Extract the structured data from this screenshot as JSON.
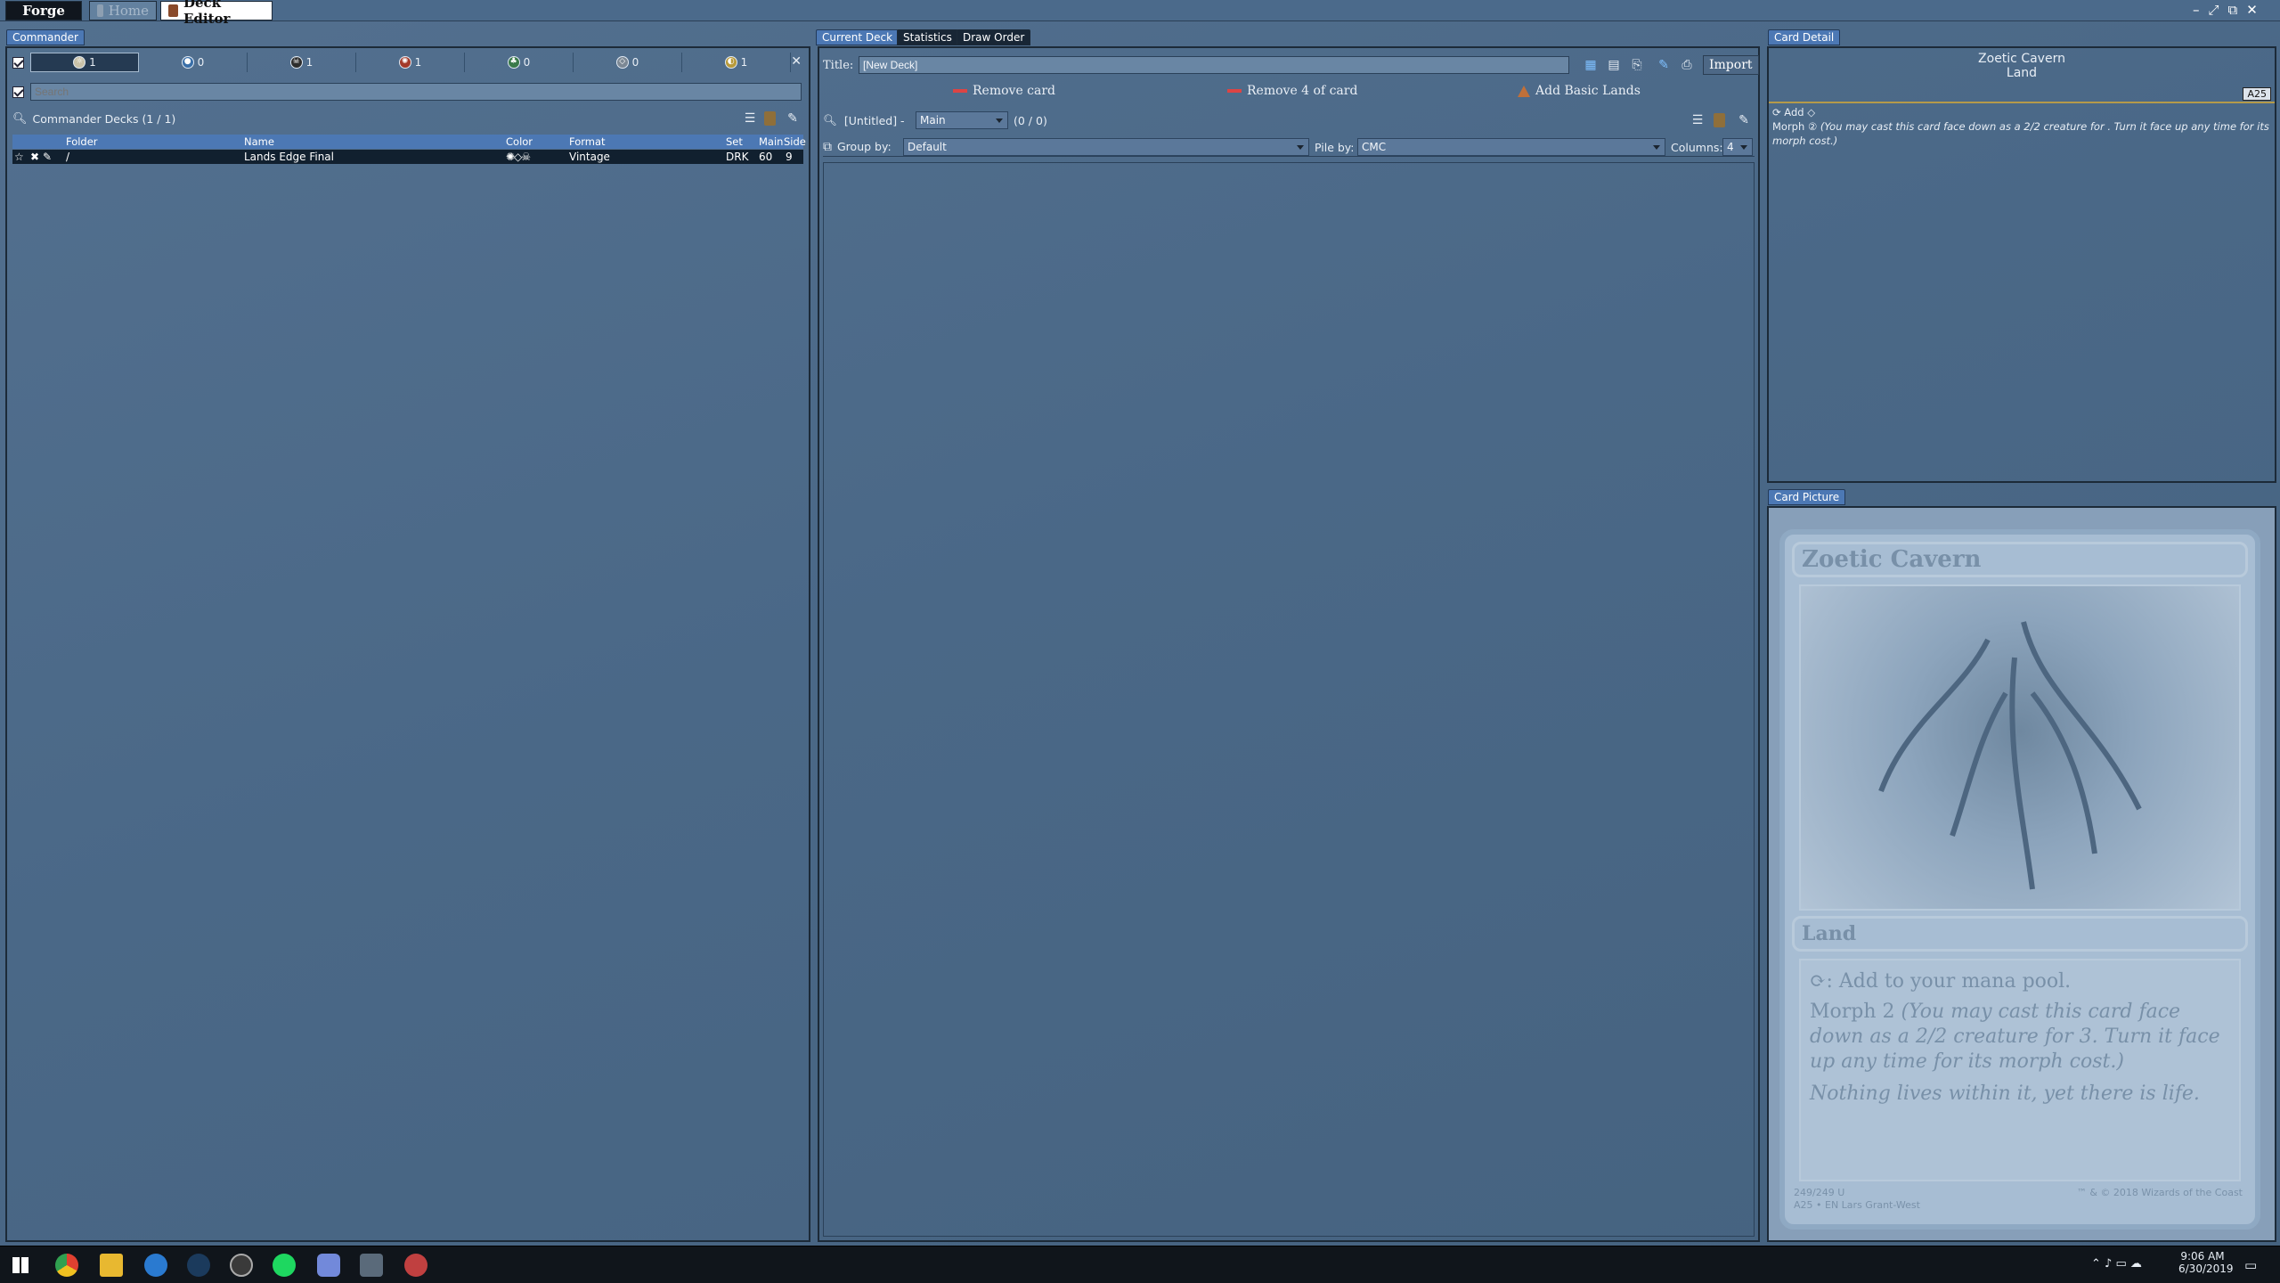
{
  "window": {
    "tabs": [
      {
        "label": "Forge"
      },
      {
        "label": "Home"
      },
      {
        "label": "Deck Editor"
      }
    ],
    "controls": [
      "–",
      "⤢",
      "⧉",
      "✕"
    ]
  },
  "left": {
    "tab_label": "Commander",
    "filters": [
      {
        "count": "1",
        "icon": "white-mana"
      },
      {
        "count": "0",
        "icon": "blue-mana"
      },
      {
        "count": "1",
        "icon": "black-mana"
      },
      {
        "count": "1",
        "icon": "red-mana"
      },
      {
        "count": "0",
        "icon": "green-mana"
      },
      {
        "count": "0",
        "icon": "colorless-mana"
      },
      {
        "count": "1",
        "icon": "multicolor-mana"
      }
    ],
    "search_placeholder": "Search",
    "catalog_label": "Commander Decks (1 / 1)",
    "columns": {
      "folder": "Folder",
      "name": "Name",
      "color": "Color",
      "format": "Format",
      "set": "Set",
      "main": "Main",
      "side": "Side"
    },
    "rows": [
      {
        "folder": "/",
        "name": "Lands Edge Final",
        "format": "Vintage",
        "set": "DRK",
        "main": "60",
        "side": "9"
      }
    ]
  },
  "center": {
    "tabs": [
      {
        "label": "Current Deck"
      },
      {
        "label": "Statistics"
      },
      {
        "label": "Draw Order"
      }
    ],
    "title_label": "Title:",
    "title_value": "[New Deck]",
    "import_label": "Import",
    "actions": {
      "remove_card": "Remove card",
      "remove_4": "Remove 4 of card",
      "add_basic": "Add Basic Lands"
    },
    "section_label": "[Untitled] -",
    "section_select": "Main",
    "count": "(0 / 0)",
    "group_by_label": "Group by:",
    "group_by_value": "Default",
    "pile_by_label": "Pile by:",
    "pile_by_value": "CMC",
    "columns_label": "Columns:",
    "columns_value": "4"
  },
  "right": {
    "detail_tab": "Card Detail",
    "card_name": "Zoetic Cavern",
    "card_type": "Land",
    "set_badge": "A25",
    "ability_add": "Add",
    "ability_morph_prefix": "Morph",
    "ability_morph_text": "(You may cast this card face down as a 2/2 creature for . Turn it face up any time for its morph cost.)",
    "picture_tab": "Card Picture",
    "art": {
      "name": "Zoetic Cavern",
      "type": "Land",
      "rules1": ": Add  to your mana pool.",
      "rules2_prefix": "Morph 2",
      "rules2": "(You may cast this card face down as a 2/2 creature for 3. Turn it face up any time for its morph cost.)",
      "flavor": "Nothing lives within it, yet there is life.",
      "collector": "249/249 U",
      "set_line": "A25 • EN  Lars Grant-West",
      "copyright": "™ & © 2018 Wizards of the Coast"
    }
  },
  "taskbar": {
    "time": "9:06 AM",
    "date": "6/30/2019"
  },
  "colors": {
    "accent": "#4c78b4",
    "panel_bg": "#4a6887",
    "dark": "#11202f"
  }
}
